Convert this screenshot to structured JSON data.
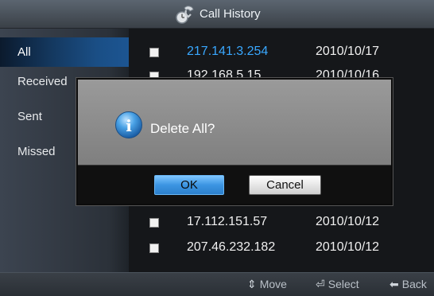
{
  "window": {
    "title": "Call History"
  },
  "sidebar": {
    "items": [
      {
        "label": "All",
        "selected": true
      },
      {
        "label": "Received",
        "selected": false
      },
      {
        "label": "Sent",
        "selected": false
      },
      {
        "label": "Missed",
        "selected": false
      }
    ]
  },
  "list": {
    "rows": [
      {
        "ip": "217.141.3.254",
        "date": "2010/10/17",
        "highlight": true
      },
      {
        "ip": "192.168.5.15",
        "date": "2010/10/16",
        "highlight": false
      },
      {
        "ip": "17.112.151.57",
        "date": "2010/10/12",
        "highlight": false
      },
      {
        "ip": "207.46.232.182",
        "date": "2010/10/12",
        "highlight": false
      }
    ]
  },
  "footer": {
    "move_label": "Move",
    "move_glyph": "⇕",
    "select_label": "Select",
    "select_glyph": "⏎",
    "back_label": "Back",
    "back_glyph": "⬅"
  },
  "dialog": {
    "message": "Delete All?",
    "icon": "info-icon",
    "ok_label": "OK",
    "cancel_label": "Cancel"
  },
  "colors": {
    "accent": "#39a8ff",
    "selected_bg": "#1a4e85",
    "ok_button": "#3c95e2"
  }
}
